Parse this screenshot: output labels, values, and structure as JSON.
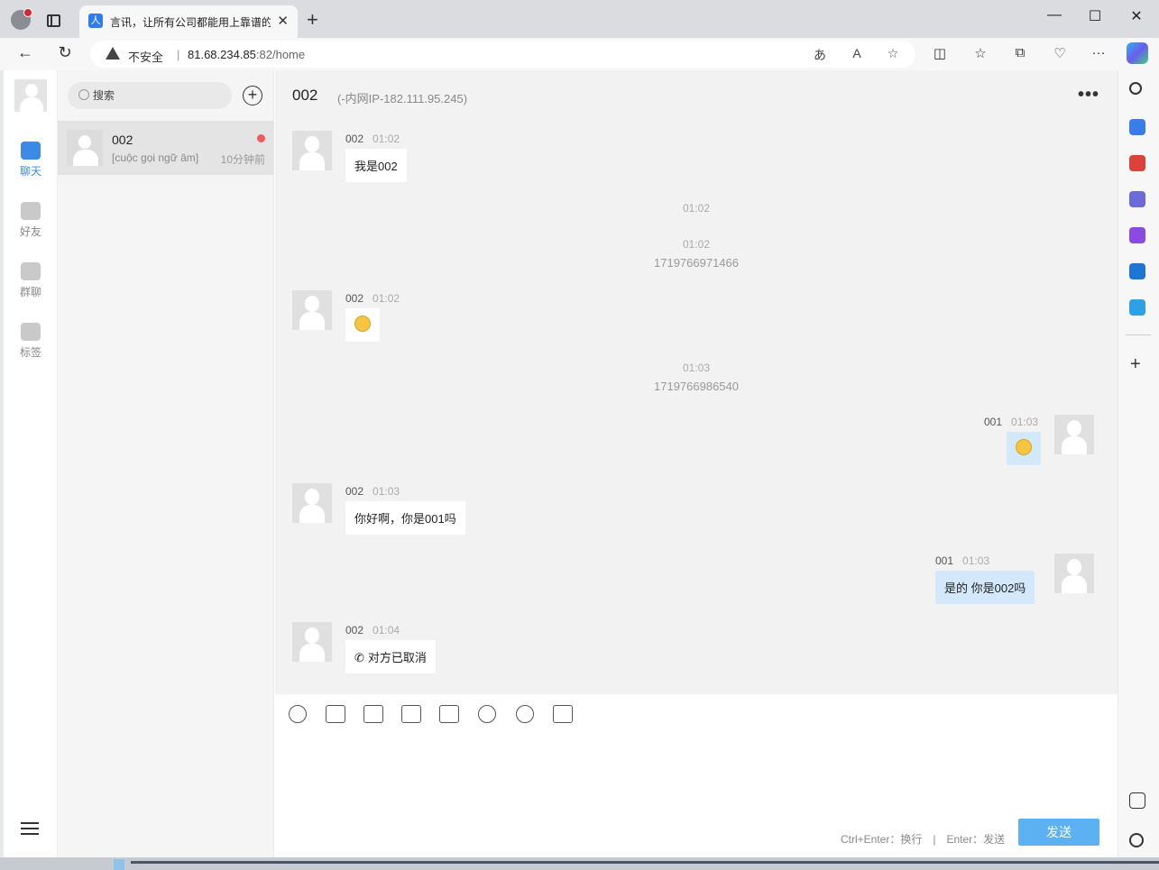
{
  "browser": {
    "tab_title": "言讯，让所有公司都能用上靠谱的",
    "tab_favicon": "人",
    "new_tab": "+",
    "close_tab": "✕",
    "security_label": "不安全",
    "url_host": "81.68.234.85",
    "url_rest": ":82/home",
    "window_controls": [
      "—",
      "☐",
      "✕"
    ]
  },
  "app": {
    "nav": [
      {
        "label": "聊天",
        "icon": "chat-icon",
        "active": true
      },
      {
        "label": "好友",
        "icon": "friends-icon",
        "active": false
      },
      {
        "label": "群聊",
        "icon": "group-chat-icon",
        "active": false
      },
      {
        "label": "标签",
        "icon": "tags-icon",
        "active": false
      }
    ],
    "search_placeholder": "搜索",
    "add_symbol": "+",
    "conversation": {
      "name": "002",
      "preview": "[cuộc gọi ngữ âm]",
      "time": "10分钟前"
    }
  },
  "chat": {
    "title": "002",
    "subtitle": "(-内网IP-182.111.95.245)",
    "more": "•••",
    "messages": {
      "m1": {
        "sender": "002",
        "time": "01:02",
        "text": "我是002"
      },
      "sys1": {
        "time": "01:02"
      },
      "sys2": {
        "time": "01:02",
        "text": "1719766971466"
      },
      "m2": {
        "sender": "002",
        "time": "01:02",
        "emoji": "frowning-face"
      },
      "sys3": {
        "time": "01:03",
        "text": "1719766986540"
      },
      "m3": {
        "sender": "001",
        "time": "01:03",
        "emoji": "pensive-face"
      },
      "m4": {
        "sender": "002",
        "time": "01:03",
        "text": "你好啊，你是001吗"
      },
      "m5": {
        "sender": "001",
        "time": "01:03",
        "text": "是的 你是002吗"
      },
      "m6": {
        "sender": "002",
        "time": "01:04",
        "text": "对方已取消"
      }
    },
    "compose": {
      "hint": "Ctrl+Enter：换行　|　Enter：发送",
      "send_label": "发送"
    }
  },
  "colors": {
    "accent": "#3b8ae6",
    "my_bubble": "#d4e8fb",
    "send_button": "#5cb1f3",
    "unread_dot": "#f05a5a"
  }
}
